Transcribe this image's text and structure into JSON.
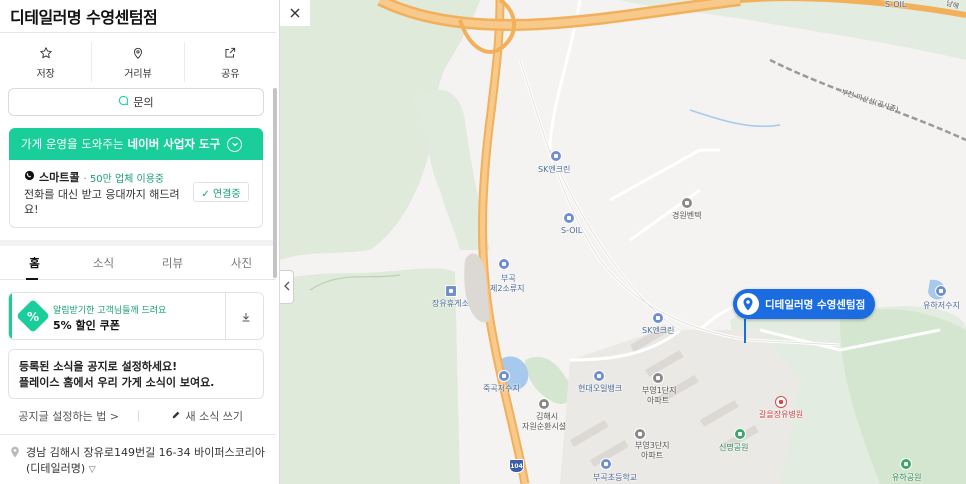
{
  "place": {
    "name": "디테일러명 수영센텀점",
    "address": "경남 김해시 장유로149번길 16-34 바이퍼스코리아(디테일러명)"
  },
  "actions": [
    {
      "label": "저장",
      "icon": "star-icon"
    },
    {
      "label": "거리뷰",
      "icon": "street-view-pin-icon"
    },
    {
      "label": "공유",
      "icon": "share-icon"
    }
  ],
  "inquiry": {
    "label": "문의",
    "icon": "chat-icon"
  },
  "business_banner": {
    "prefix": "가게 운영을 도와주는",
    "strong": "네이버 사업자 도구",
    "color": "#19ce9b"
  },
  "smart_call": {
    "name": "스마트콜",
    "usage": "· 50만 업체 이용중",
    "description": "전화를 대신 받고 응대까지 해드려요!",
    "button": "✓ 연결중"
  },
  "tabs": [
    {
      "label": "홈",
      "active": true
    },
    {
      "label": "소식",
      "active": false
    },
    {
      "label": "리뷰",
      "active": false
    },
    {
      "label": "사진",
      "active": false
    }
  ],
  "coupon": {
    "badge": "%",
    "subtitle": "알림받기한 고객님들께 드려요",
    "title": "5% 할인 쿠폰"
  },
  "notice": {
    "line1": "등록된 소식을 공지로 설정하세요!",
    "line2": "플레이스 홈에서 우리 가게 소식이 보여요."
  },
  "links": {
    "how_to": "공지글 설정하는 법 >",
    "write": "새 소식 쓰기"
  },
  "map": {
    "marker_label": "디테일러명 수영센텀점",
    "highway_shield": "104",
    "labels": {
      "sk1": "SK엔크린",
      "soil1": "S-OIL",
      "soil_top": "S-OIL",
      "gyeongwon": "경원벤텍",
      "bugok": "부곡",
      "jaeri": "제2소류지",
      "jangyu_rest": "장유휴게소",
      "sk2": "SK엔크린",
      "hyundai": "현대오일뱅크",
      "bogae": "부영1단지",
      "bogae_apt": "아파트",
      "bogae3": "부영3단지",
      "bogae3_apt": "아파트",
      "jukgok": "죽곡저수지",
      "gimhae": "김해시",
      "gimhae2": "자원순환시설",
      "galeul": "갈을장유병원",
      "sinmyeong": "신명공원",
      "bugokes": "부곡초등학교",
      "yuha": "유하저수지",
      "yuha_park": "유하공원",
      "road1": "부천-마산선(공사중)",
      "road2": "남해"
    }
  },
  "colors": {
    "accent": "#19ce9b",
    "marker": "#1a6ce0",
    "highway": "#f2b05b"
  }
}
